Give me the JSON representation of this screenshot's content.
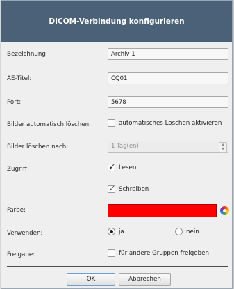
{
  "dialog": {
    "title": "DICOM-Verbindung konfigurieren"
  },
  "form": {
    "bezeichnung": {
      "label": "Bezeichnung:",
      "value": "Archiv 1"
    },
    "ae_titel": {
      "label": "AE-Titel:",
      "value": "CQ01"
    },
    "port": {
      "label": "Port:",
      "value": "5678"
    },
    "auto_loeschen": {
      "label": "Bilder automatisch löschen:",
      "checkbox_label": "automatisches Löschen aktivieren",
      "checked": false
    },
    "loeschen_nach": {
      "label": "Bilder löschen nach:",
      "value": "1 Tag(en)",
      "enabled": false
    },
    "zugriff": {
      "label": "Zugriff:",
      "lesen": {
        "label": "Lesen",
        "checked": true
      },
      "schreiben": {
        "label": "Schreiben",
        "checked": true
      }
    },
    "farbe": {
      "label": "Farbe:",
      "color": "#ff0000"
    },
    "verwenden": {
      "label": "Verwenden:",
      "options": [
        "ja",
        "nein"
      ],
      "selected": "ja"
    },
    "freigabe": {
      "label": "Freigabe:",
      "checkbox_label": "für andere Gruppen freigeben",
      "checked": false
    }
  },
  "buttons": {
    "ok": "OK",
    "cancel": "Abbrechen"
  },
  "icons": {
    "check": "checkmark-icon",
    "color_picker": "color-wheel-icon"
  },
  "colors": {
    "titlebar": "#4a6178",
    "accent": "#ff0000"
  }
}
